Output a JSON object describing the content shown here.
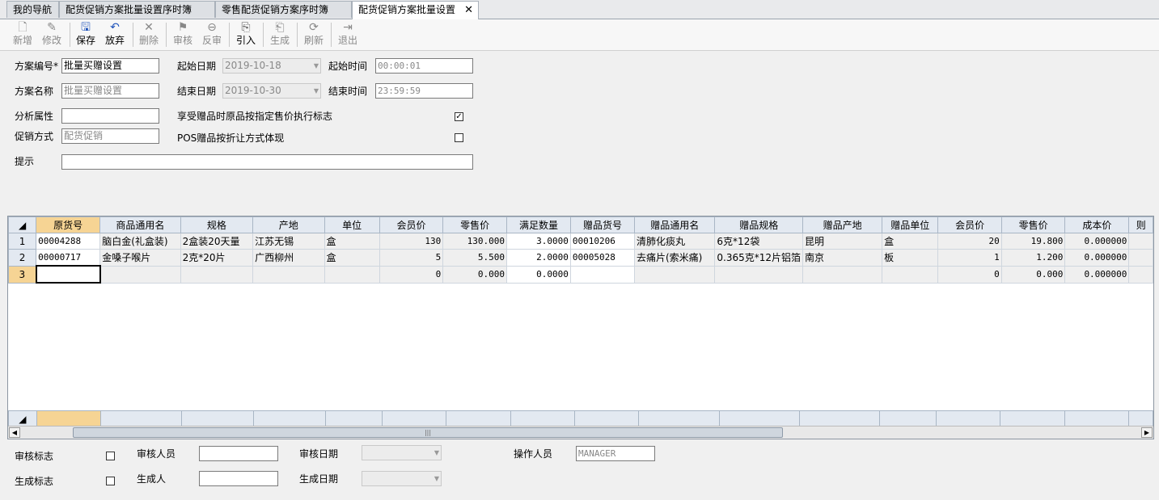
{
  "tabs": [
    {
      "label": "我的导航"
    },
    {
      "label": "配货促销方案批量设置序时簿"
    },
    {
      "label": "零售配货促销方案序时簿"
    },
    {
      "label": "配货促销方案批量设置"
    }
  ],
  "toolbar": {
    "new": "新增",
    "edit": "修改",
    "save": "保存",
    "discard": "放弃",
    "delete": "删除",
    "audit": "审核",
    "unaudit": "反审",
    "import": "引入",
    "generate": "生成",
    "refresh": "刷新",
    "exit": "退出"
  },
  "form": {
    "plan_no_label": "方案编号*",
    "plan_no": "批量买赠设置",
    "start_date_label": "起始日期",
    "start_date": "2019-10-18",
    "start_time_label": "起始时间",
    "start_time": "00:00:01",
    "plan_name_label": "方案名称",
    "plan_name": "批量买赠设置",
    "end_date_label": "结束日期",
    "end_date": "2019-10-30",
    "end_time_label": "结束时间",
    "end_time": "23:59:59",
    "attr_label": "分析属性",
    "attr": "",
    "gift_price_label": "享受赠品时原品按指定售价执行标志",
    "gift_price_checked": true,
    "promo_label": "促销方式",
    "promo": "配货促销",
    "pos_label": "POS赠品按折让方式体现",
    "pos_checked": false,
    "hint_label": "提示",
    "hint": ""
  },
  "grid": {
    "columns": [
      "原货号",
      "商品通用名",
      "规格",
      "产地",
      "单位",
      "会员价",
      "零售价",
      "满足数量",
      "赠品货号",
      "赠品通用名",
      "赠品规格",
      "赠品产地",
      "赠品单位",
      "会员价",
      "零售价",
      "成本价",
      "则"
    ],
    "rows": [
      {
        "no": "1",
        "cells": [
          "00004288",
          "脑白金(礼盒装)",
          "2盒装20天量",
          "江苏无锡",
          "盒",
          "130",
          "130.000",
          "3.0000",
          "00010206",
          "清肺化痰丸",
          "6克*12袋",
          "昆明",
          "盒",
          "20",
          "19.800",
          "0.000000",
          ""
        ]
      },
      {
        "no": "2",
        "cells": [
          "00000717",
          "金嗓子喉片",
          "2克*20片",
          "广西柳州",
          "盒",
          "5",
          "5.500",
          "2.0000",
          "00005028",
          "去痛片(索米痛)",
          "0.365克*12片铝箔",
          "南京",
          "板",
          "1",
          "1.200",
          "0.000000",
          ""
        ]
      },
      {
        "no": "3",
        "cells": [
          "",
          "",
          "",
          "",
          "",
          "0",
          "0.000",
          "0.0000",
          "",
          "",
          "",
          "",
          "",
          "0",
          "0.000",
          "0.000000",
          ""
        ]
      }
    ]
  },
  "footer": {
    "audit_flag_label": "审核标志",
    "audit_flag_checked": false,
    "auditor_label": "审核人员",
    "auditor": "",
    "audit_date_label": "审核日期",
    "audit_date": "",
    "operator_label": "操作人员",
    "operator": "MANAGER",
    "gen_flag_label": "生成标志",
    "gen_flag_checked": false,
    "generator_label": "生成人",
    "generator": "",
    "gen_date_label": "生成日期",
    "gen_date": ""
  }
}
